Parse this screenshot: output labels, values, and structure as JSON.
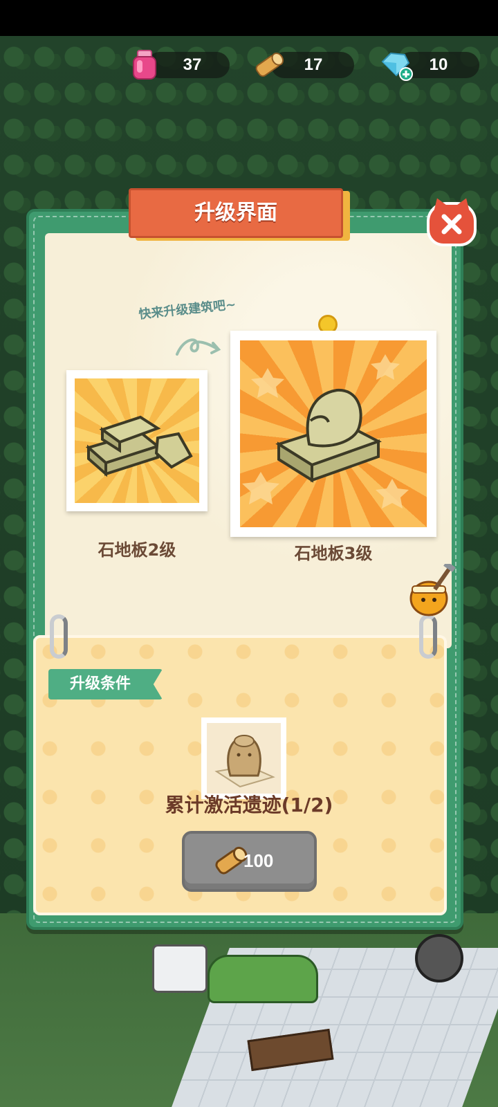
{
  "resources": {
    "potion": {
      "icon": "pink-potion-icon",
      "value": "37"
    },
    "wood": {
      "icon": "wood-log-icon",
      "value": "17"
    },
    "gem": {
      "icon": "blue-gem-plus-icon",
      "value": "10"
    }
  },
  "dialog": {
    "title": "升级界面",
    "hint": "快来升级建筑吧~",
    "current": {
      "label": "石地板2级",
      "icon": "stone-floor-level-2"
    },
    "next": {
      "label": "石地板3级",
      "icon": "stone-floor-level-3"
    },
    "conditions_tag": "升级条件",
    "requirement": {
      "icon": "ancient-relic-statue-icon",
      "text": "累计激活遗迹(1/2)"
    },
    "cost": {
      "icon": "wood-log-icon",
      "value": "100"
    }
  },
  "colors": {
    "frame_green": "#3f9b6f",
    "title_orange": "#e86a43",
    "close_red": "#e5523b",
    "paper": "#f7efd8",
    "paper_bottom": "#fbe4ad",
    "button_gray": "#8e8e8e"
  }
}
